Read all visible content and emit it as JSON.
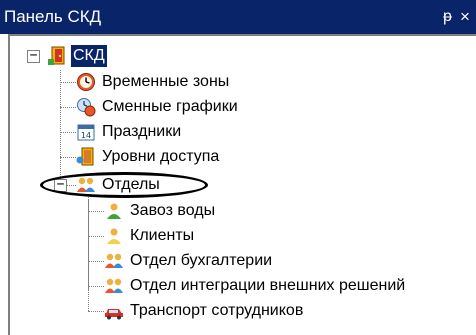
{
  "panel": {
    "title": "Панель СКД",
    "pin_glyph": "ᵽ",
    "close_glyph": "×"
  },
  "tree": {
    "root": {
      "label": "СКД",
      "expander": "−",
      "icon": "building-door-icon"
    },
    "items": [
      {
        "label": "Временные зоны",
        "icon": "clock-icon"
      },
      {
        "label": "Сменные графики",
        "icon": "shift-schedule-icon"
      },
      {
        "label": "Праздники",
        "icon": "calendar-icon"
      },
      {
        "label": "Уровни доступа",
        "icon": "access-door-icon"
      },
      {
        "label": "Отделы",
        "icon": "people-group-icon",
        "expander": "−"
      }
    ],
    "departments": [
      {
        "label": "Завоз воды",
        "icon": "person-green-icon"
      },
      {
        "label": "Клиенты",
        "icon": "person-yellow-icon"
      },
      {
        "label": "Отдел бухгалтерии",
        "icon": "people-group-icon"
      },
      {
        "label": "Отдел интеграции внешних решений",
        "icon": "people-group-icon"
      },
      {
        "label": "Транспорт сотрудников",
        "icon": "car-icon"
      }
    ]
  },
  "colors": {
    "titlebar": "#0a246a",
    "selection": "#0a246a",
    "annotation": "#000000"
  }
}
